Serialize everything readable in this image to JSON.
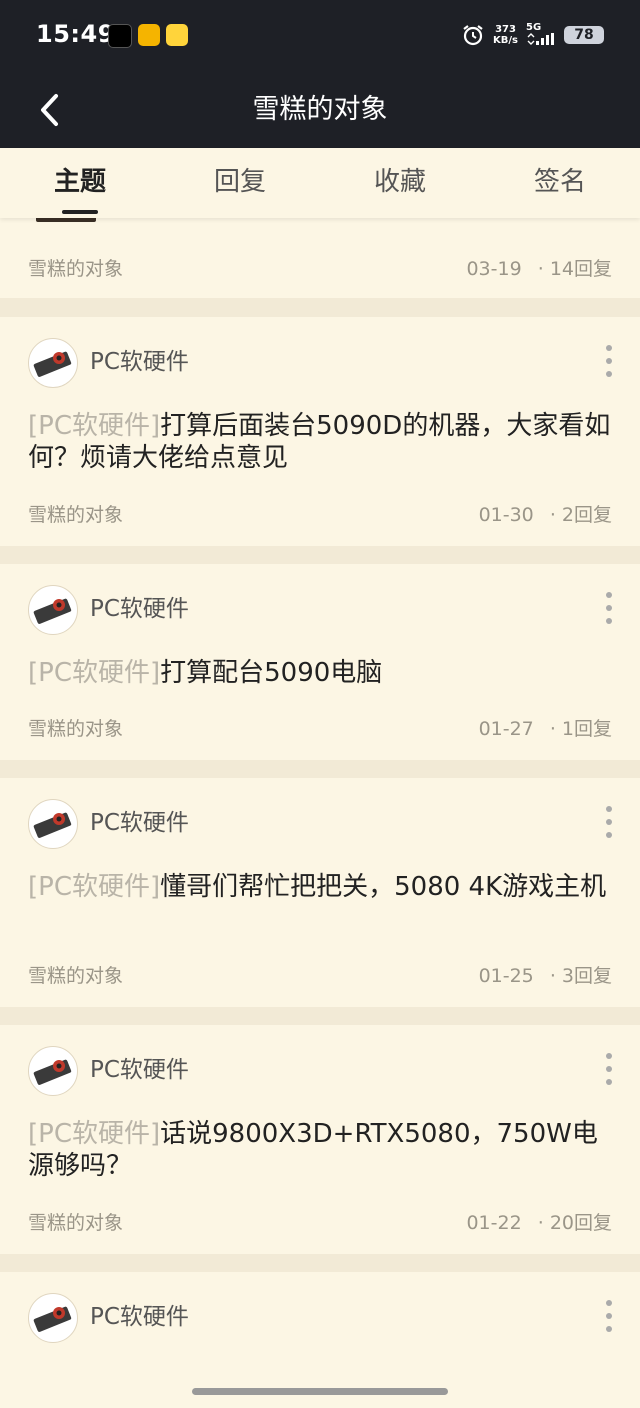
{
  "status_bar": {
    "time": "15:49",
    "net_speed": "373",
    "net_unit": "KB/s",
    "signal": "5G",
    "battery": "78"
  },
  "header": {
    "back_icon": "chevron-left-icon",
    "title": "雪糕的对象"
  },
  "tabs": [
    {
      "label": "主题",
      "active": true
    },
    {
      "label": "回复",
      "active": false
    },
    {
      "label": "收藏",
      "active": false
    },
    {
      "label": "签名",
      "active": false
    }
  ],
  "posts": [
    {
      "author": "雪糕的对象",
      "date": "03-19",
      "replies": "· 14回复"
    },
    {
      "forum": "PC软硬件",
      "tag": "[PC软硬件]",
      "title": "打算后面装台5090D的机器，大家看如何？烦请大佬给点意见",
      "author": "雪糕的对象",
      "date": "01-30",
      "replies": "· 2回复"
    },
    {
      "forum": "PC软硬件",
      "tag": "[PC软硬件]",
      "title": "打算配台5090电脑",
      "author": "雪糕的对象",
      "date": "01-27",
      "replies": "· 1回复"
    },
    {
      "forum": "PC软硬件",
      "tag": "[PC软硬件]",
      "title": "懂哥们帮忙把把关，5080 4K游戏主机",
      "author": "雪糕的对象",
      "date": "01-25",
      "replies": "· 3回复"
    },
    {
      "forum": "PC软硬件",
      "tag": "[PC软硬件]",
      "title": "话说9800X3D+RTX5080，750W电源够吗？",
      "author": "雪糕的对象",
      "date": "01-22",
      "replies": "· 20回复"
    },
    {
      "forum": "PC软硬件"
    }
  ]
}
